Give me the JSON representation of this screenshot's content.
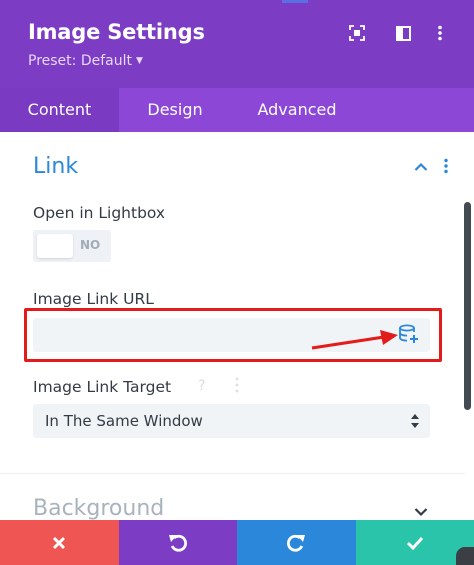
{
  "header": {
    "title": "Image Settings",
    "preset": "Preset: Default",
    "icons": [
      "focus-icon",
      "sidebar-layout-icon",
      "more-vertical-icon"
    ]
  },
  "tabs": [
    {
      "label": "Content",
      "active": true
    },
    {
      "label": "Design",
      "active": false
    },
    {
      "label": "Advanced",
      "active": false
    }
  ],
  "section": {
    "title": "Link",
    "fields": {
      "lightbox": {
        "label": "Open in Lightbox",
        "value": "NO"
      },
      "url": {
        "label": "Image Link URL",
        "value": "",
        "action_icon": "dynamic-content-icon"
      },
      "target": {
        "label": "Image Link Target",
        "value": "In The Same Window"
      }
    }
  },
  "next_section": {
    "title": "Background"
  },
  "footer": {
    "buttons": [
      "close-icon",
      "undo-icon",
      "redo-icon",
      "check-icon"
    ]
  },
  "colors": {
    "header": "#7d3cc4",
    "tabs": "#8c47d6",
    "accent_blue": "#2b87da",
    "annotation_red": "#e31b1b",
    "close": "#ef5553",
    "save": "#29c4a9"
  }
}
